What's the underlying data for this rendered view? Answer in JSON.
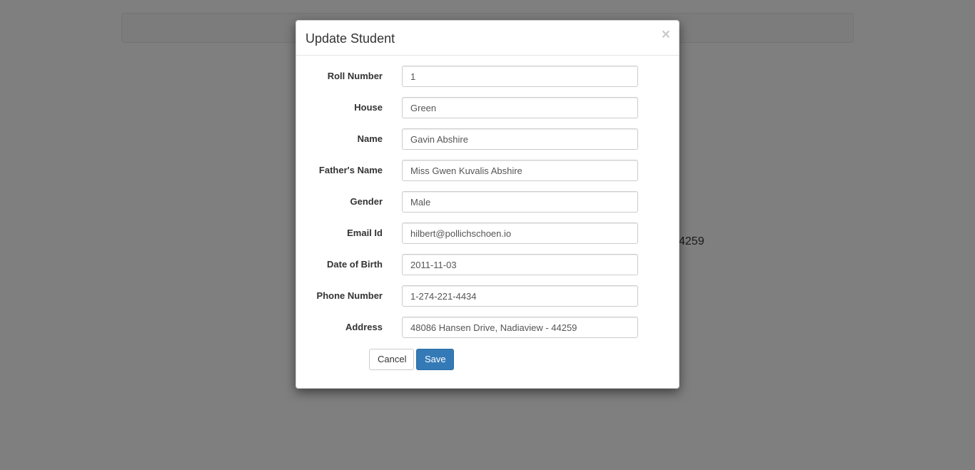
{
  "background": {
    "partial_text": "4259"
  },
  "modal": {
    "title": "Update Student",
    "close_glyph": "×",
    "fields": [
      {
        "label": "Roll Number",
        "value": "1"
      },
      {
        "label": "House",
        "value": "Green"
      },
      {
        "label": "Name",
        "value": "Gavin Abshire"
      },
      {
        "label": "Father's Name",
        "value": "Miss Gwen Kuvalis Abshire"
      },
      {
        "label": "Gender",
        "value": "Male"
      },
      {
        "label": "Email Id",
        "value": "hilbert@pollichschoen.io"
      },
      {
        "label": "Date of Birth",
        "value": "2011-11-03"
      },
      {
        "label": "Phone Number",
        "value": "1-274-221-4434"
      },
      {
        "label": "Address",
        "value": "48086 Hansen Drive, Nadiaview - 44259"
      }
    ],
    "cancel_label": "Cancel",
    "save_label": "Save"
  },
  "colors": {
    "primary": "#337ab7",
    "backdrop": "rgba(0,0,0,0.5)"
  }
}
